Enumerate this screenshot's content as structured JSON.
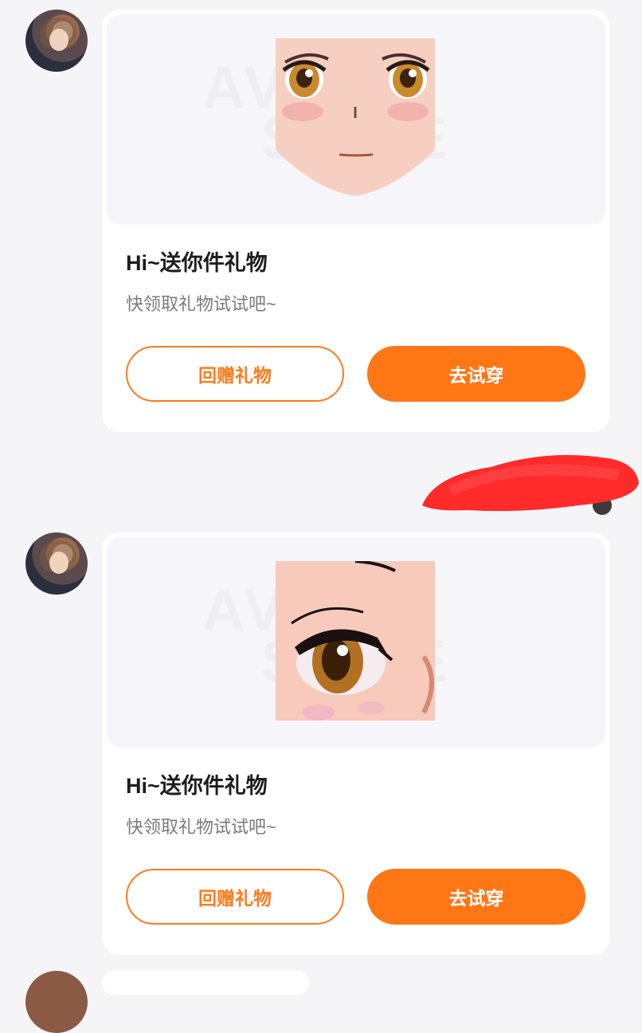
{
  "messages": [
    {
      "title": "Hi~送你件礼物",
      "subtitle": "快领取礼物试试吧~",
      "return_gift_label": "回赠礼物",
      "try_on_label": "去试穿",
      "thumbnail": "anime-face"
    },
    {
      "title": "Hi~送你件礼物",
      "subtitle": "快领取礼物试试吧~",
      "return_gift_label": "回赠礼物",
      "try_on_label": "去试穿",
      "thumbnail": "anime-eye-closeup"
    }
  ],
  "colors": {
    "accent": "#ff7615",
    "background": "#f5f5f8",
    "card": "#ffffff",
    "redaction": "#ff2a2a"
  }
}
